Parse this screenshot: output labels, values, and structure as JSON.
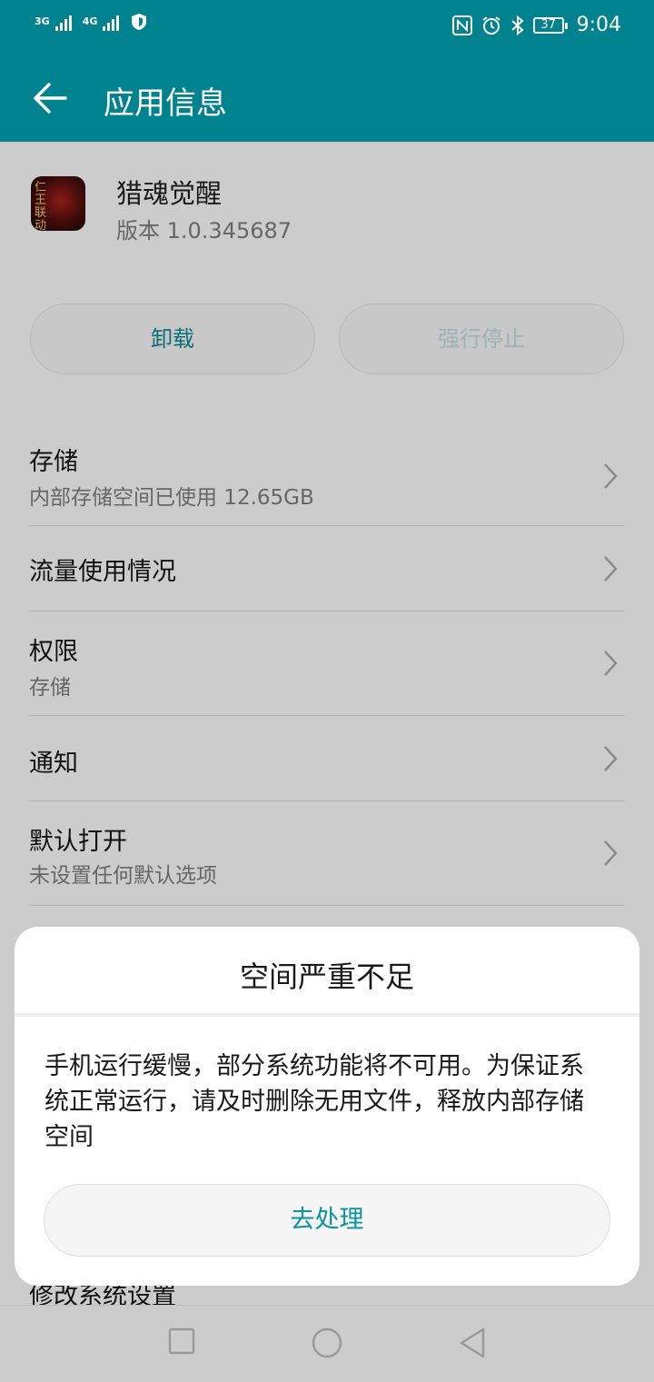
{
  "status_bar": {
    "network_1": "3G",
    "network_2": "4G",
    "battery": "37",
    "time": "9:04",
    "icons": [
      "signal-icon",
      "signal-icon",
      "security-shield-icon",
      "nfc-icon",
      "alarm-icon",
      "bluetooth-icon",
      "battery-icon"
    ]
  },
  "app_bar": {
    "title": "应用信息",
    "back_icon": "arrow-left-icon"
  },
  "app_info": {
    "name": "猎魂觉醒",
    "version": "版本 1.0.345687",
    "icon_text": "仁王联动"
  },
  "actions": {
    "uninstall": "卸载",
    "force_stop": "强行停止"
  },
  "settings": [
    {
      "title": "存储",
      "subtitle": "内部存储空间已使用 12.65GB"
    },
    {
      "title": "流量使用情况"
    },
    {
      "title": "权限",
      "subtitle": "存储"
    },
    {
      "title": "通知"
    },
    {
      "title": "默认打开",
      "subtitle": "未设置任何默认选项"
    }
  ],
  "partial_row": "修改系统设置",
  "dialog": {
    "title": "空间严重不足",
    "message": "手机运行缓慢，部分系统功能将不可用。为保证系统正常运行，请及时删除无用文件，释放内部存储空间",
    "button": "去处理"
  },
  "colors": {
    "accent": "#009ba6",
    "dialog_button_text": "#0c94a1"
  }
}
